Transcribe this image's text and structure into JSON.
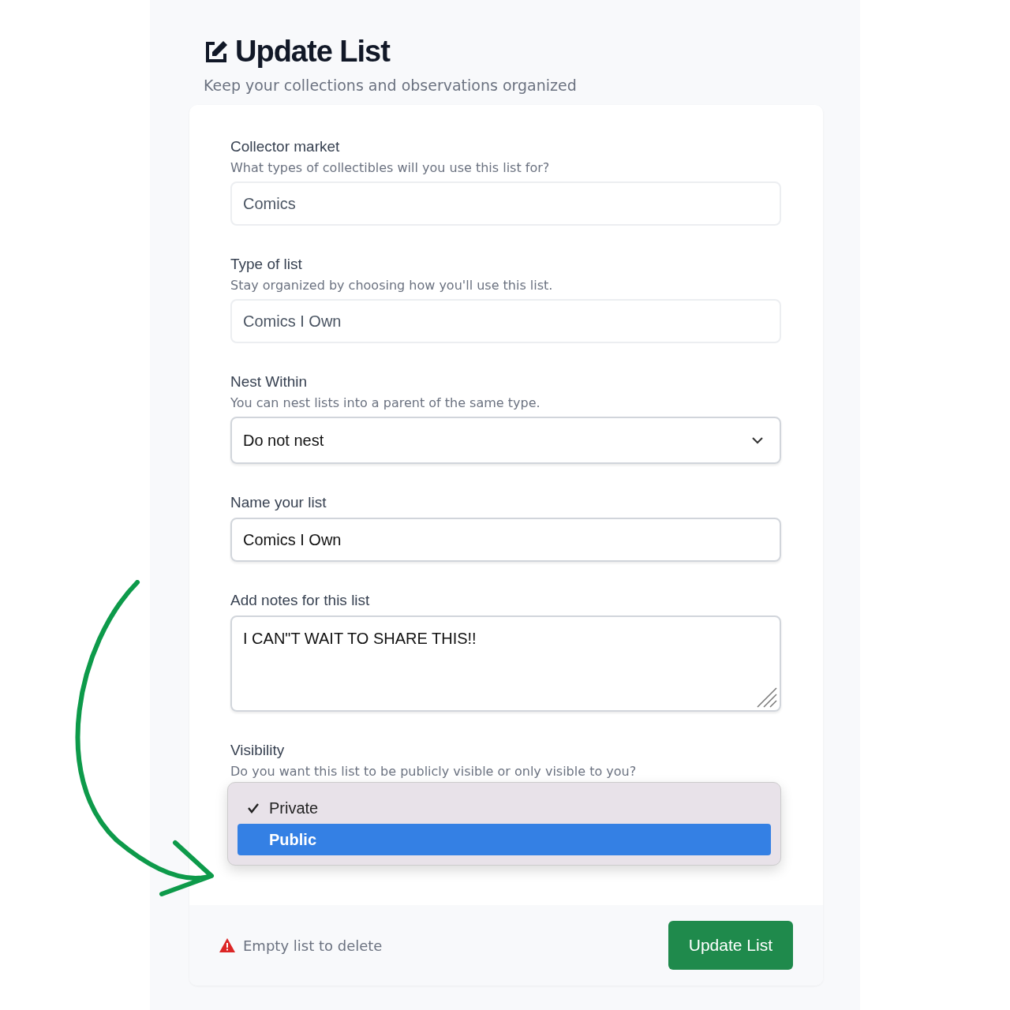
{
  "header": {
    "title": "Update List",
    "subtitle": "Keep your collections and observations organized"
  },
  "fields": [
    {
      "kind": "input",
      "label": "Collector market",
      "hint": "What types of collectibles will you use this list for?",
      "value": "Comics",
      "disabled": true
    },
    {
      "kind": "input",
      "label": "Type of list",
      "hint": "Stay organized by choosing how you'll use this list.",
      "value": "Comics I Own",
      "disabled": true
    },
    {
      "kind": "select",
      "label": "Nest Within",
      "hint": "You can nest lists into a parent of the same type.",
      "value": "Do not nest",
      "disabled": false
    },
    {
      "kind": "input",
      "label": "Name your list",
      "value": "Comics I Own",
      "disabled": false
    },
    {
      "kind": "textarea",
      "label": "Add notes for this list",
      "value": "I CAN\"T WAIT TO SHARE THIS!!",
      "disabled": false
    }
  ],
  "visibility": {
    "label": "Visibility",
    "hint": "Do you want this list to be publicly visible or only visible to you?",
    "options": [
      {
        "label": "Private",
        "checked": true,
        "highlighted": false
      },
      {
        "label": "Public",
        "checked": false,
        "highlighted": true
      }
    ]
  },
  "footer": {
    "warning": "Empty list to delete",
    "button": "Update List"
  }
}
